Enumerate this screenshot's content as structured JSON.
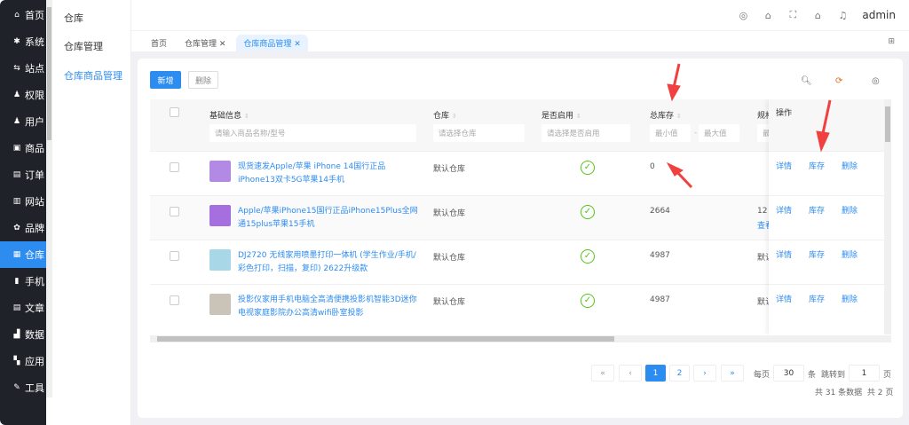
{
  "sidebar": {
    "items": [
      {
        "icon": "home-icon",
        "glyph": "⌂",
        "label": "首页"
      },
      {
        "icon": "gear-icon",
        "glyph": "✱",
        "label": "系统"
      },
      {
        "icon": "sliders-icon",
        "glyph": "⇆",
        "label": "站点"
      },
      {
        "icon": "user-lock-icon",
        "glyph": "♟",
        "label": "权限"
      },
      {
        "icon": "user-icon",
        "glyph": "♟",
        "label": "用户"
      },
      {
        "icon": "goods-icon",
        "glyph": "▣",
        "label": "商品"
      },
      {
        "icon": "order-icon",
        "glyph": "▤",
        "label": "订单"
      },
      {
        "icon": "website-icon",
        "glyph": "▥",
        "label": "网站"
      },
      {
        "icon": "brand-icon",
        "glyph": "✿",
        "label": "品牌"
      },
      {
        "icon": "warehouse-icon",
        "glyph": "▦",
        "label": "仓库",
        "active": true
      },
      {
        "icon": "phone-icon",
        "glyph": "▮",
        "label": "手机"
      },
      {
        "icon": "article-icon",
        "glyph": "▤",
        "label": "文章"
      },
      {
        "icon": "chart-icon",
        "glyph": "▟",
        "label": "数据"
      },
      {
        "icon": "apps-icon",
        "glyph": "▚",
        "label": "应用"
      },
      {
        "icon": "wrench-icon",
        "glyph": "✎",
        "label": "工具"
      }
    ]
  },
  "submenu": {
    "title": "仓库",
    "items": [
      "仓库管理",
      "仓库商品管理"
    ]
  },
  "header": {
    "user": "admin"
  },
  "tabs": [
    "首页",
    "仓库管理 ✕",
    "仓库商品管理 ✕"
  ],
  "toolbar": {
    "add": "新增",
    "delete": "删除"
  },
  "table": {
    "headers": {
      "basic": "基础信息",
      "warehouse": "仓库",
      "enabled": "是否启用",
      "stock": "总库存",
      "spec": "规格",
      "actions": "操作"
    },
    "filters": {
      "basic": "请输入商品名称/型号",
      "warehouse": "请选择仓库",
      "enabled": "请选择是否启用",
      "min": "最小值",
      "max": "最大值",
      "spec": "最"
    },
    "rows": [
      {
        "name": "现货速发Apple/苹果 iPhone 14国行正品iPhone13双卡5G苹果14手机",
        "warehouse": "默认仓库",
        "stock": "0",
        "spec": "",
        "spec2": "",
        "color": "#b28ae6"
      },
      {
        "name": "Apple/苹果iPhone15国行正品iPhone15Plus全网通15plus苹果15手机",
        "warehouse": "默认仓库",
        "stock": "2664",
        "spec": "12",
        "spec2": "查看",
        "color": "#a66fe0"
      },
      {
        "name": "DJ2720 无线家用喷墨打印一体机 (学生作业/手机/彩色打印，扫描，复印) 2622升级款",
        "warehouse": "默认仓库",
        "stock": "4987",
        "spec": "默认",
        "spec2": "",
        "color": "#a8d8e8"
      },
      {
        "name": "投影仪家用手机电脑全高清便携投影机智能3D迷你电视家庭影院办公高清wifi卧室投影",
        "warehouse": "默认仓库",
        "stock": "4987",
        "spec": "默认",
        "spec2": "",
        "color": "#c9c3b8"
      }
    ],
    "actions": [
      "详情",
      "库存",
      "删除"
    ]
  },
  "pagination": {
    "first": "«",
    "prev": "‹",
    "pages": [
      "1",
      "2"
    ],
    "current": "1",
    "next": "›",
    "last": "»",
    "per_page_label": "每页",
    "per_page": "30",
    "per_page_unit": "条",
    "jump_label": "跳转到",
    "jump_value": "1",
    "jump_unit": "页",
    "summary": "共 31 条数据  共 2 页"
  },
  "colors": {
    "accent": "#2d8cf0",
    "sidebar": "#1f2229",
    "success": "#52c41a",
    "annotation": "#f04040"
  }
}
